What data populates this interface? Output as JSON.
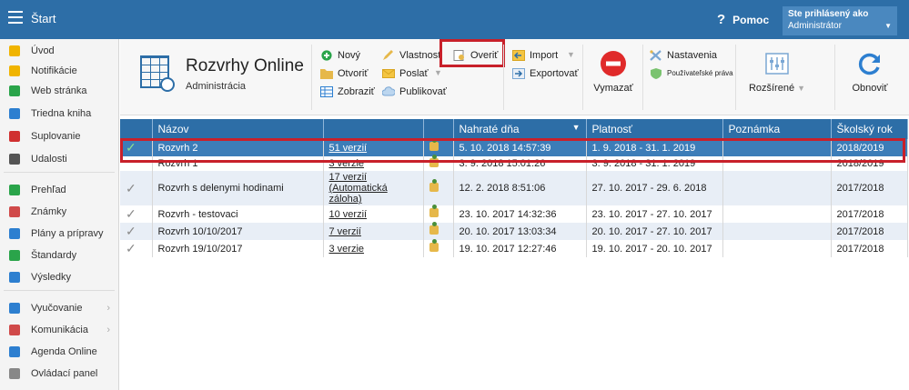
{
  "app": {
    "title": "Štart",
    "help_label": "Pomoc",
    "user_caption": "Ste prihlásený ako",
    "user_name": "Administrátor"
  },
  "sidebar": {
    "items": [
      {
        "label": "Úvod",
        "icon": "star-icon",
        "color": "#f0b400"
      },
      {
        "label": "Notifikácie",
        "icon": "envelope-icon",
        "color": "#f0b400"
      },
      {
        "label": "Web stránka",
        "icon": "home-icon",
        "color": "#2aa44a"
      },
      {
        "label": "Triedna kniha",
        "icon": "book-icon",
        "color": "#2d7fd0"
      },
      {
        "label": "Suplovanie",
        "icon": "substitution-icon",
        "color": "#d03030"
      },
      {
        "label": "Udalosti",
        "icon": "calendar-icon",
        "color": "#555555"
      },
      {
        "label": "Prehľad",
        "icon": "overview-icon",
        "color": "#2aa44a"
      },
      {
        "label": "Známky",
        "icon": "grades-icon",
        "color": "#d04a4a"
      },
      {
        "label": "Plány a prípravy",
        "icon": "plans-icon",
        "color": "#2d7fd0"
      },
      {
        "label": "Štandardy",
        "icon": "shield-icon",
        "color": "#2aa44a"
      },
      {
        "label": "Výsledky",
        "icon": "bar-chart-icon",
        "color": "#2d7fd0"
      },
      {
        "label": "Vyučovanie",
        "icon": "teaching-icon",
        "color": "#2d7fd0",
        "chevron": "›"
      },
      {
        "label": "Komunikácia",
        "icon": "chat-icon",
        "color": "#d04a4a",
        "chevron": "›"
      },
      {
        "label": "Agenda Online",
        "icon": "pen-icon",
        "color": "#2d7fd0"
      },
      {
        "label": "Ovládací panel",
        "icon": "gear-icon",
        "color": "#888888"
      }
    ]
  },
  "ribbon": {
    "brand_title": "Rozvrhy Online",
    "brand_subtitle": "Administrácia",
    "new": "Nový",
    "open": "Otvoriť",
    "view": "Zobraziť",
    "properties": "Vlastnosti",
    "send": "Poslať",
    "publish": "Publikovať",
    "verify": "Overiť",
    "import": "Import",
    "export": "Exportovať",
    "delete": "Vymazať",
    "settings": "Nastavenia",
    "user_rights": "Používateľské práva",
    "advanced": "Rozšírené",
    "refresh": "Obnoviť"
  },
  "table": {
    "columns": [
      "Názov",
      "",
      "",
      "Nahraté dňa",
      "Platnosť",
      "Poznámka",
      "Školský rok"
    ],
    "rows": [
      {
        "checked": true,
        "name": "Rozvrh 2",
        "versions": "51 verzií",
        "uploaded": "5. 10. 2018 14:57:39",
        "validity": "1. 9. 2018 - 31. 1. 2019",
        "note": "",
        "year": "2018/2019"
      },
      {
        "checked": false,
        "name": "Rozvrh 1",
        "versions": "3 verzie",
        "uploaded": "3. 9. 2018 15:01:26",
        "validity": "3. 9. 2018 - 31. 1. 2019",
        "note": "",
        "year": "2018/2019"
      },
      {
        "checked": true,
        "name": "Rozvrh s delenymi hodinami",
        "versions": "17 verzií (Automatická záloha)",
        "uploaded": "12. 2. 2018 8:51:06",
        "validity": "27. 10. 2017 - 29. 6. 2018",
        "note": "",
        "year": "2017/2018"
      },
      {
        "checked": true,
        "name": "Rozvrh - testovaci",
        "versions": "10 verzií",
        "uploaded": "23. 10. 2017 14:32:36",
        "validity": "23. 10. 2017 - 27. 10. 2017",
        "note": "",
        "year": "2017/2018"
      },
      {
        "checked": true,
        "name": "Rozvrh 10/10/2017",
        "versions": "7 verzií",
        "uploaded": "20. 10. 2017 13:03:34",
        "validity": "20. 10. 2017 - 27. 10. 2017",
        "note": "",
        "year": "2017/2018"
      },
      {
        "checked": true,
        "name": "Rozvrh 19/10/2017",
        "versions": "3 verzie",
        "uploaded": "19. 10. 2017 12:27:46",
        "validity": "19. 10. 2017 - 20. 10. 2017",
        "note": "",
        "year": "2017/2018"
      }
    ]
  },
  "colors": {
    "accent": "#2d6ea7",
    "highlight": "#c8202a",
    "selected_row": "#3c7db8"
  }
}
